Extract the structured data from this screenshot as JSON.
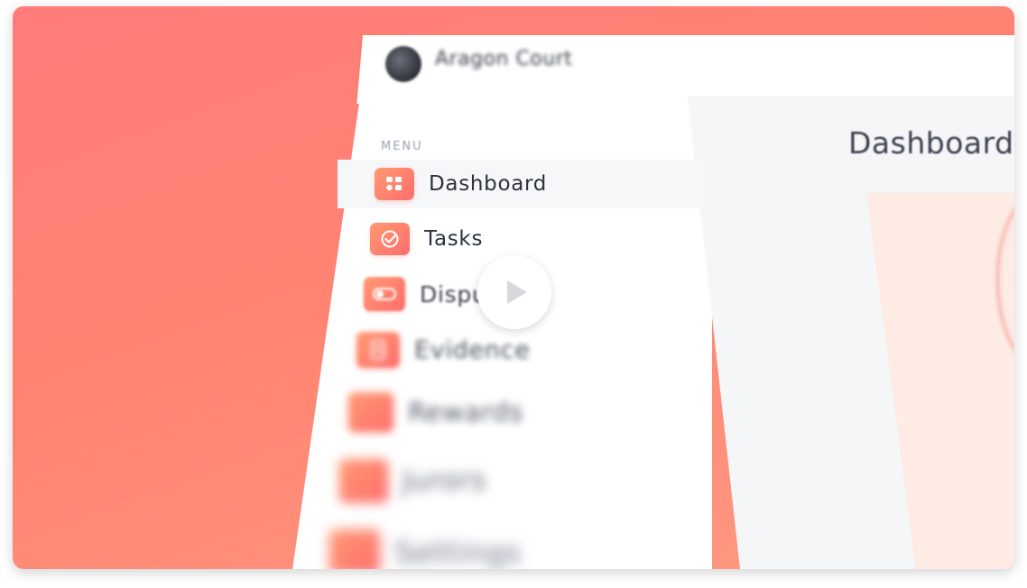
{
  "header": {
    "org_name": "Aragon Court"
  },
  "sidebar": {
    "section_label": "MENU",
    "items": [
      {
        "label": "Dashboard",
        "icon": "dashboard-grid-icon",
        "active": true
      },
      {
        "label": "Tasks",
        "icon": "tasks-check-icon",
        "active": false
      },
      {
        "label": "Disputes",
        "icon": "disputes-toggle-icon",
        "active": false
      },
      {
        "label": "Evidence",
        "icon": "evidence-document-icon",
        "active": false
      },
      {
        "label": "Rewards",
        "icon": "rewards-icon",
        "active": false
      },
      {
        "label": "Jurors",
        "icon": "jurors-icon",
        "active": false
      },
      {
        "label": "Settings",
        "icon": "settings-icon",
        "active": false
      }
    ]
  },
  "main": {
    "title": "Dashboard"
  },
  "video": {
    "play_icon": "play-icon"
  },
  "colors": {
    "background_gradient_start": "#ff7c7a",
    "background_gradient_end": "#ff9b83",
    "icon_gradient_start": "#ff9a72",
    "icon_gradient_end": "#ff6d6d",
    "text_dark": "#2c3240"
  }
}
